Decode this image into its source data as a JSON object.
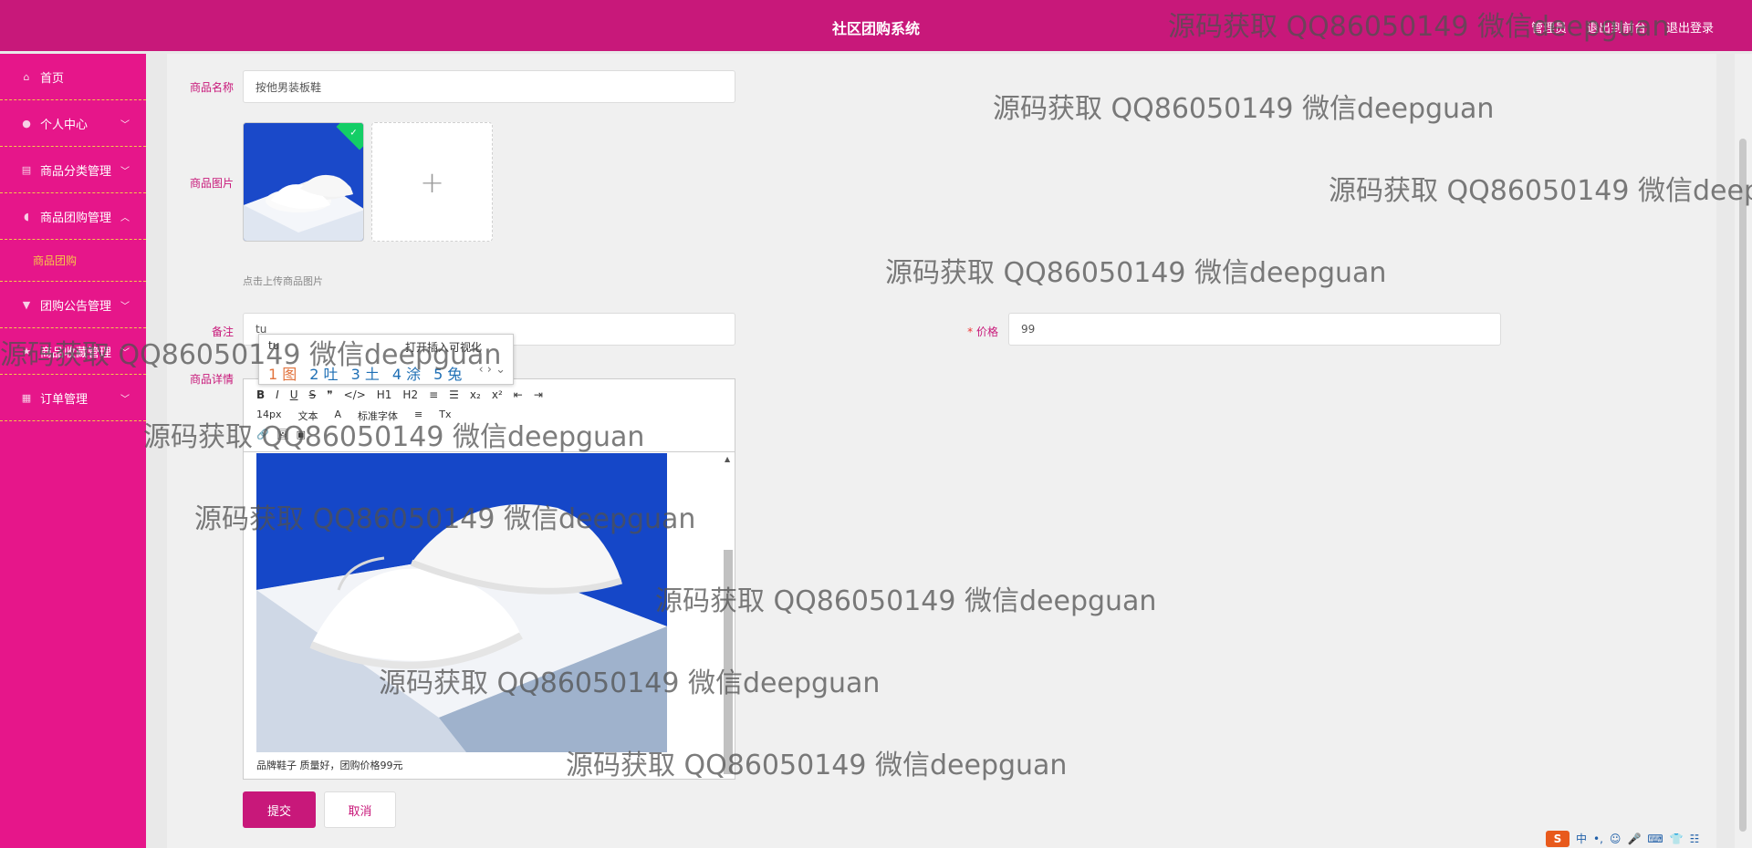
{
  "header": {
    "title": "社区团购系统",
    "nav": [
      "管理员",
      "退出到前台",
      "退出登录"
    ]
  },
  "sidebar": {
    "items": [
      {
        "label": "首页",
        "icon": "home-icon"
      },
      {
        "label": "个人中心",
        "icon": "user-icon"
      },
      {
        "label": "商品分类管理",
        "icon": "clipboard-icon"
      },
      {
        "label": "商品团购管理",
        "icon": "bulb-icon"
      },
      {
        "label": "团购公告管理",
        "icon": "flag-icon"
      },
      {
        "label": "商品收藏管理",
        "icon": "star-icon"
      },
      {
        "label": "订单管理",
        "icon": "grid-icon"
      }
    ],
    "sub_item": "商品团购"
  },
  "form": {
    "name_label": "商品名称",
    "name_value": "按他男装板鞋",
    "image_label": "商品图片",
    "image_hint": "点击上传商品图片",
    "note_label": "备注",
    "note_value": "tu",
    "price_label": "价格",
    "price_required": "*",
    "price_value": "99",
    "detail_label": "商品详情",
    "submit_label": "提交",
    "cancel_label": "取消"
  },
  "ime": {
    "composition": "tu",
    "hint": "打开插入可视化",
    "candidates": [
      "1 图",
      "2 吐",
      "3 土",
      "4 涂",
      "5 兔"
    ]
  },
  "editor": {
    "toolbar_row1": [
      "B",
      "I",
      "U",
      "S",
      "❞",
      "</>",
      "H1",
      "H2",
      "≡",
      "☰",
      "x₂",
      "x²",
      "⇤",
      "⇥"
    ],
    "toolbar_row2": [
      "14px",
      "文本",
      "A",
      "标准字体",
      "≡",
      "Tx"
    ],
    "toolbar_row3": [
      "🔗",
      "🖼",
      "▣"
    ],
    "content_text": "品牌鞋子 质量好，团购价格99元"
  },
  "watermark": "源码获取 QQ86050149 微信deepguan",
  "tray": [
    "中",
    "•,",
    "☺",
    "🎤",
    "⌨",
    "👕",
    "☷"
  ],
  "colors": {
    "header": "#c8187a",
    "sidebar": "#e6168a",
    "accent": "#f2c94c"
  }
}
